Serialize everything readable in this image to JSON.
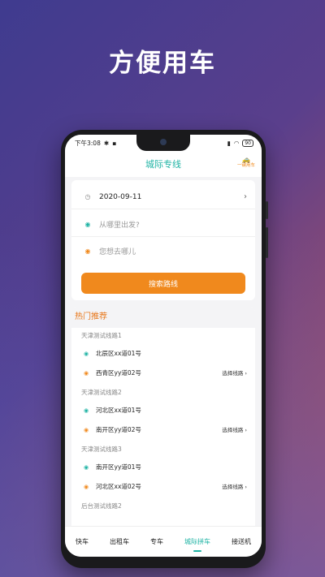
{
  "hero": {
    "title": "方便用车"
  },
  "status": {
    "time": "下午3:08",
    "battery": "90"
  },
  "header": {
    "title": "城际专线",
    "right_label": "一键用车"
  },
  "form": {
    "date": "2020-09-11",
    "from_placeholder": "从哪里出发?",
    "to_placeholder": "您想去哪儿",
    "search_label": "搜索路线"
  },
  "hot": {
    "title": "热门推荐",
    "choose_label": "选择线路",
    "routes": [
      {
        "name": "天津测试线路1",
        "from": "北辰区xx道01号",
        "to": "西青区yy道02号"
      },
      {
        "name": "天津测试线路2",
        "from": "河北区xx道01号",
        "to": "南开区yy道02号"
      },
      {
        "name": "天津测试线路3",
        "from": "南开区yy道01号",
        "to": "河北区xx道02号"
      },
      {
        "name": "后台测试线路2"
      }
    ]
  },
  "tabs": [
    "快车",
    "出租车",
    "专车",
    "城际拼车",
    "接送机"
  ],
  "colors": {
    "accent": "#1fb3a4",
    "orange": "#f0891d"
  }
}
